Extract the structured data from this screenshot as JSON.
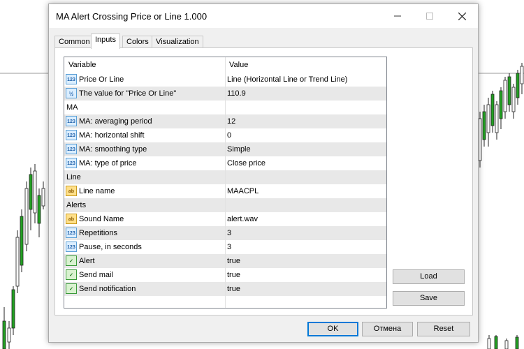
{
  "window": {
    "title": "MA Alert Crossing Price or Line 1.000",
    "minimize_icon": "minimize-icon",
    "maximize_icon": "maximize-icon",
    "close_icon": "close-icon"
  },
  "tabs": [
    {
      "label": "Common",
      "active": false
    },
    {
      "label": "Inputs",
      "active": true
    },
    {
      "label": "Colors",
      "active": false
    },
    {
      "label": "Visualization",
      "active": false
    }
  ],
  "grid": {
    "headers": {
      "variable": "Variable",
      "value": "Value"
    },
    "rows": [
      {
        "type": "param",
        "icon": "123",
        "name": "Price Or Line",
        "value": "Line (Horizontal Line or Trend Line)",
        "alt": false
      },
      {
        "type": "param",
        "icon": "1/2",
        "name": "The value for \"Price Or Line\"",
        "value": "110.9",
        "alt": true
      },
      {
        "type": "group",
        "name": "MA",
        "value": "",
        "alt": false
      },
      {
        "type": "param",
        "icon": "123",
        "name": "MA: averaging period",
        "value": "12",
        "alt": true
      },
      {
        "type": "param",
        "icon": "123",
        "name": "MA: horizontal shift",
        "value": "0",
        "alt": false
      },
      {
        "type": "param",
        "icon": "123",
        "name": "MA: smoothing type",
        "value": "Simple",
        "alt": true
      },
      {
        "type": "param",
        "icon": "123",
        "name": "MA: type of price",
        "value": "Close price",
        "alt": false
      },
      {
        "type": "group",
        "name": "Line",
        "value": "",
        "alt": true
      },
      {
        "type": "param",
        "icon": "ab",
        "name": "Line name",
        "value": "MAACPL",
        "alt": false
      },
      {
        "type": "group",
        "name": "Alerts",
        "value": "",
        "alt": true
      },
      {
        "type": "param",
        "icon": "ab",
        "name": "Sound Name",
        "value": "alert.wav",
        "alt": false
      },
      {
        "type": "param",
        "icon": "123",
        "name": "Repetitions",
        "value": "3",
        "alt": true
      },
      {
        "type": "param",
        "icon": "123",
        "name": "Pause, in seconds",
        "value": "3",
        "alt": false
      },
      {
        "type": "param",
        "icon": "bool",
        "name": "Alert",
        "value": "true",
        "alt": true
      },
      {
        "type": "param",
        "icon": "bool",
        "name": "Send mail",
        "value": "true",
        "alt": false
      },
      {
        "type": "param",
        "icon": "bool",
        "name": "Send notification",
        "value": "true",
        "alt": true
      }
    ]
  },
  "side_buttons": {
    "load": "Load",
    "save": "Save"
  },
  "footer_buttons": {
    "ok": "OK",
    "cancel": "Отмена",
    "reset": "Reset"
  },
  "colors": {
    "accent": "#0078d7",
    "bull": "#22a022",
    "bear": "#111111"
  }
}
